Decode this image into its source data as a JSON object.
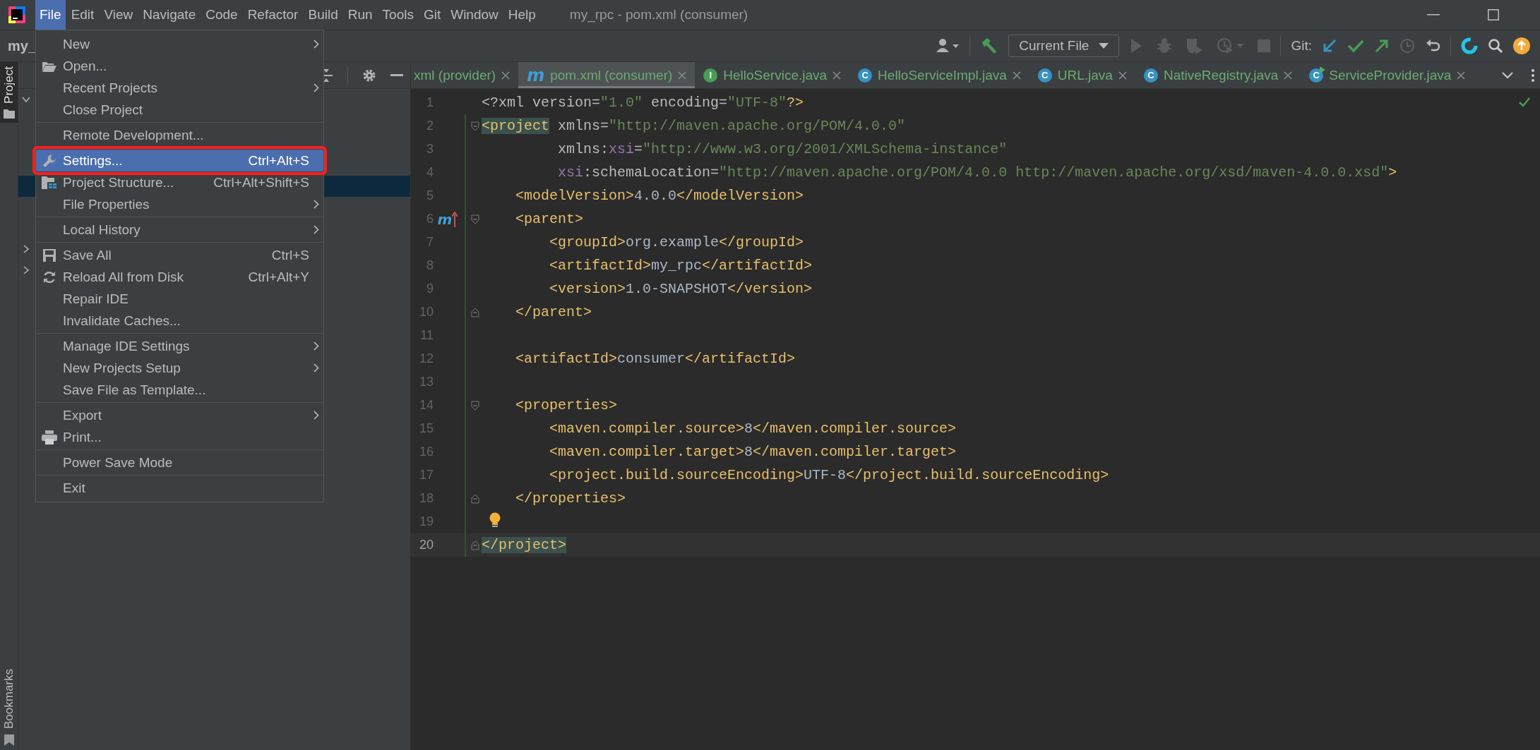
{
  "menubar": [
    {
      "label": "File",
      "selected": true
    },
    {
      "label": "Edit",
      "selected": false
    },
    {
      "label": "View",
      "selected": false
    },
    {
      "label": "Navigate",
      "selected": false
    },
    {
      "label": "Code",
      "selected": false
    },
    {
      "label": "Refactor",
      "selected": false
    },
    {
      "label": "Build",
      "selected": false
    },
    {
      "label": "Run",
      "selected": false
    },
    {
      "label": "Tools",
      "selected": false
    },
    {
      "label": "Git",
      "selected": false
    },
    {
      "label": "Window",
      "selected": false
    },
    {
      "label": "Help",
      "selected": false
    }
  ],
  "window": {
    "title": "my_rpc - pom.xml (consumer)"
  },
  "toolbar": {
    "project": "my_",
    "run_config": "Current File",
    "run_controls_disabled": true,
    "git_label": "Git:"
  },
  "tool_strip": [
    {
      "label": "Project",
      "selected": true
    },
    {
      "label": "Bookmarks",
      "selected": false
    }
  ],
  "project_tree": [
    {
      "expanded": true,
      "selected": false
    },
    {
      "selected": true
    },
    {
      "expanded": false,
      "selected": false
    },
    {
      "expanded": false,
      "selected": false
    }
  ],
  "file_menu": [
    [
      {
        "label": "New",
        "submenu": true,
        "selected": false,
        "outlined": false
      },
      {
        "label": "Open...",
        "kind": "folder",
        "submenu": false,
        "selected": false,
        "outlined": false
      },
      {
        "label": "Recent Projects",
        "submenu": true,
        "selected": false,
        "outlined": false
      },
      {
        "label": "Close Project",
        "submenu": false,
        "selected": false,
        "outlined": false
      }
    ],
    [
      {
        "label": "Remote Development...",
        "submenu": false,
        "selected": false,
        "outlined": false
      }
    ],
    [
      {
        "label": "Settings...",
        "kind": "wrench",
        "shortcut": "Ctrl+Alt+S",
        "submenu": false,
        "selected": true,
        "outlined": true
      },
      {
        "label": "Project Structure...",
        "kind": "structure",
        "shortcut": "Ctrl+Alt+Shift+S",
        "submenu": false,
        "selected": false,
        "outlined": false
      },
      {
        "label": "File Properties",
        "submenu": true,
        "selected": false,
        "outlined": false
      }
    ],
    [
      {
        "label": "Local History",
        "submenu": true,
        "selected": false,
        "outlined": false
      }
    ],
    [
      {
        "label": "Save All",
        "kind": "save",
        "shortcut": "Ctrl+S",
        "submenu": false,
        "selected": false,
        "outlined": false
      },
      {
        "label": "Reload All from Disk",
        "kind": "reload",
        "shortcut": "Ctrl+Alt+Y",
        "submenu": false,
        "selected": false,
        "outlined": false
      },
      {
        "label": "Repair IDE",
        "submenu": false,
        "selected": false,
        "outlined": false
      },
      {
        "label": "Invalidate Caches...",
        "submenu": false,
        "selected": false,
        "outlined": false
      }
    ],
    [
      {
        "label": "Manage IDE Settings",
        "submenu": true,
        "selected": false,
        "outlined": false
      },
      {
        "label": "New Projects Setup",
        "submenu": true,
        "selected": false,
        "outlined": false
      },
      {
        "label": "Save File as Template...",
        "submenu": false,
        "selected": false,
        "outlined": false
      }
    ],
    [
      {
        "label": "Export",
        "submenu": true,
        "selected": false,
        "outlined": false
      },
      {
        "label": "Print...",
        "kind": "print",
        "submenu": false,
        "selected": false,
        "outlined": false
      }
    ],
    [
      {
        "label": "Power Save Mode",
        "submenu": false,
        "selected": false,
        "outlined": false
      }
    ],
    [
      {
        "label": "Exit",
        "submenu": false,
        "selected": false,
        "outlined": false
      }
    ]
  ],
  "editor_tabs": [
    {
      "label": "xml (provider)",
      "selected": false
    },
    {
      "label": "pom.xml (consumer)",
      "selected": true,
      "icon": {
        "kind": "maven",
        "text": "m"
      }
    },
    {
      "label": "HelloService.java",
      "selected": false,
      "icon": {
        "kind": "interface",
        "text": "I"
      }
    },
    {
      "label": "HelloServiceImpl.java",
      "selected": false,
      "icon": {
        "kind": "class",
        "text": "C"
      }
    },
    {
      "label": "URL.java",
      "selected": false,
      "icon": {
        "kind": "class",
        "text": "C"
      }
    },
    {
      "label": "NativeRegistry.java",
      "selected": false,
      "icon": {
        "kind": "class",
        "text": "C"
      }
    },
    {
      "label": "ServiceProvider.java",
      "selected": false,
      "icon": {
        "kind": "runnable",
        "text": "C"
      }
    }
  ],
  "code": [
    {
      "n": "1",
      "current": false,
      "added": false,
      "tokens": [
        {
          "kind": "attr",
          "t": "<?xml version="
        },
        {
          "kind": "str",
          "t": "\"1.0\""
        },
        {
          "kind": "attr",
          "t": " encoding="
        },
        {
          "kind": "str",
          "t": "\"UTF-8\""
        },
        {
          "kind": "tag",
          "t": "?>"
        }
      ]
    },
    {
      "n": "2",
      "current": false,
      "added": true,
      "fold_start": true,
      "tokens": [
        {
          "kind": "tag",
          "t": "<project",
          "match": true
        },
        {
          "kind": "attr",
          "t": " xmlns="
        },
        {
          "kind": "str",
          "t": "\"http://maven.apache.org/POM/4.0.0\""
        }
      ]
    },
    {
      "n": "3",
      "current": false,
      "added": true,
      "tokens": [
        {
          "kind": "attr",
          "t": "         xmlns:"
        },
        {
          "kind": "ns",
          "t": "xsi"
        },
        {
          "kind": "attr",
          "t": "="
        },
        {
          "kind": "str",
          "t": "\"http://www.w3.org/2001/XMLSchema-instance\""
        }
      ]
    },
    {
      "n": "4",
      "current": false,
      "added": true,
      "tokens": [
        {
          "kind": "ns",
          "t": "         xsi"
        },
        {
          "kind": "attr",
          "t": ":schemaLocation="
        },
        {
          "kind": "str",
          "t": "\"http://maven.apache.org/POM/4.0.0 http://maven.apache.org/xsd/maven-4.0.0.xsd\""
        },
        {
          "kind": "tag",
          "t": ">"
        }
      ]
    },
    {
      "n": "5",
      "current": false,
      "added": true,
      "tokens": [
        {
          "kind": "tag",
          "t": "    <modelVersion>"
        },
        {
          "kind": "text",
          "t": "4.0.0"
        },
        {
          "kind": "tag",
          "t": "</modelVersion>"
        }
      ]
    },
    {
      "n": "6",
      "current": false,
      "added": true,
      "fold_start": true,
      "gutter": {
        "kind": "maven-parent",
        "text": "m"
      },
      "tokens": [
        {
          "kind": "tag",
          "t": "    <parent>"
        }
      ]
    },
    {
      "n": "7",
      "current": false,
      "added": true,
      "tokens": [
        {
          "kind": "tag",
          "t": "        <groupId>"
        },
        {
          "kind": "text",
          "t": "org.example"
        },
        {
          "kind": "tag",
          "t": "</groupId>"
        }
      ]
    },
    {
      "n": "8",
      "current": false,
      "added": true,
      "tokens": [
        {
          "kind": "tag",
          "t": "        <artifactId>"
        },
        {
          "kind": "text",
          "t": "my_rpc"
        },
        {
          "kind": "tag",
          "t": "</artifactId>"
        }
      ]
    },
    {
      "n": "9",
      "current": false,
      "added": true,
      "tokens": [
        {
          "kind": "tag",
          "t": "        <version>"
        },
        {
          "kind": "text",
          "t": "1.0-SNAPSHOT"
        },
        {
          "kind": "tag",
          "t": "</version>"
        }
      ]
    },
    {
      "n": "10",
      "current": false,
      "added": true,
      "fold_end": true,
      "tokens": [
        {
          "kind": "tag",
          "t": "    </parent>"
        }
      ]
    },
    {
      "n": "11",
      "current": false,
      "added": true
    },
    {
      "n": "12",
      "current": false,
      "added": true,
      "tokens": [
        {
          "kind": "tag",
          "t": "    <artifactId>"
        },
        {
          "kind": "text",
          "t": "consumer"
        },
        {
          "kind": "tag",
          "t": "</artifactId>"
        }
      ]
    },
    {
      "n": "13",
      "current": false,
      "added": true
    },
    {
      "n": "14",
      "current": false,
      "added": true,
      "fold_start": true,
      "tokens": [
        {
          "kind": "tag",
          "t": "    <properties>"
        }
      ]
    },
    {
      "n": "15",
      "current": false,
      "added": true,
      "tokens": [
        {
          "kind": "tag",
          "t": "        <maven.compiler.source>"
        },
        {
          "kind": "text",
          "t": "8"
        },
        {
          "kind": "tag",
          "t": "</maven.compiler.source>"
        }
      ]
    },
    {
      "n": "16",
      "current": false,
      "added": true,
      "tokens": [
        {
          "kind": "tag",
          "t": "        <maven.compiler.target>"
        },
        {
          "kind": "text",
          "t": "8"
        },
        {
          "kind": "tag",
          "t": "</maven.compiler.target>"
        }
      ]
    },
    {
      "n": "17",
      "current": false,
      "added": true,
      "tokens": [
        {
          "kind": "tag",
          "t": "        <project.build.sourceEncoding>"
        },
        {
          "kind": "text",
          "t": "UTF-8"
        },
        {
          "kind": "tag",
          "t": "</project.build.sourceEncoding>"
        }
      ]
    },
    {
      "n": "18",
      "current": false,
      "added": true,
      "fold_end": true,
      "tokens": [
        {
          "kind": "tag",
          "t": "    </properties>"
        }
      ]
    },
    {
      "n": "19",
      "current": false,
      "added": true,
      "bulb": true
    },
    {
      "n": "20",
      "current": true,
      "added": true,
      "fold_end": true,
      "tokens": [
        {
          "kind": "tag",
          "t": "</project>",
          "match": true
        }
      ]
    }
  ]
}
